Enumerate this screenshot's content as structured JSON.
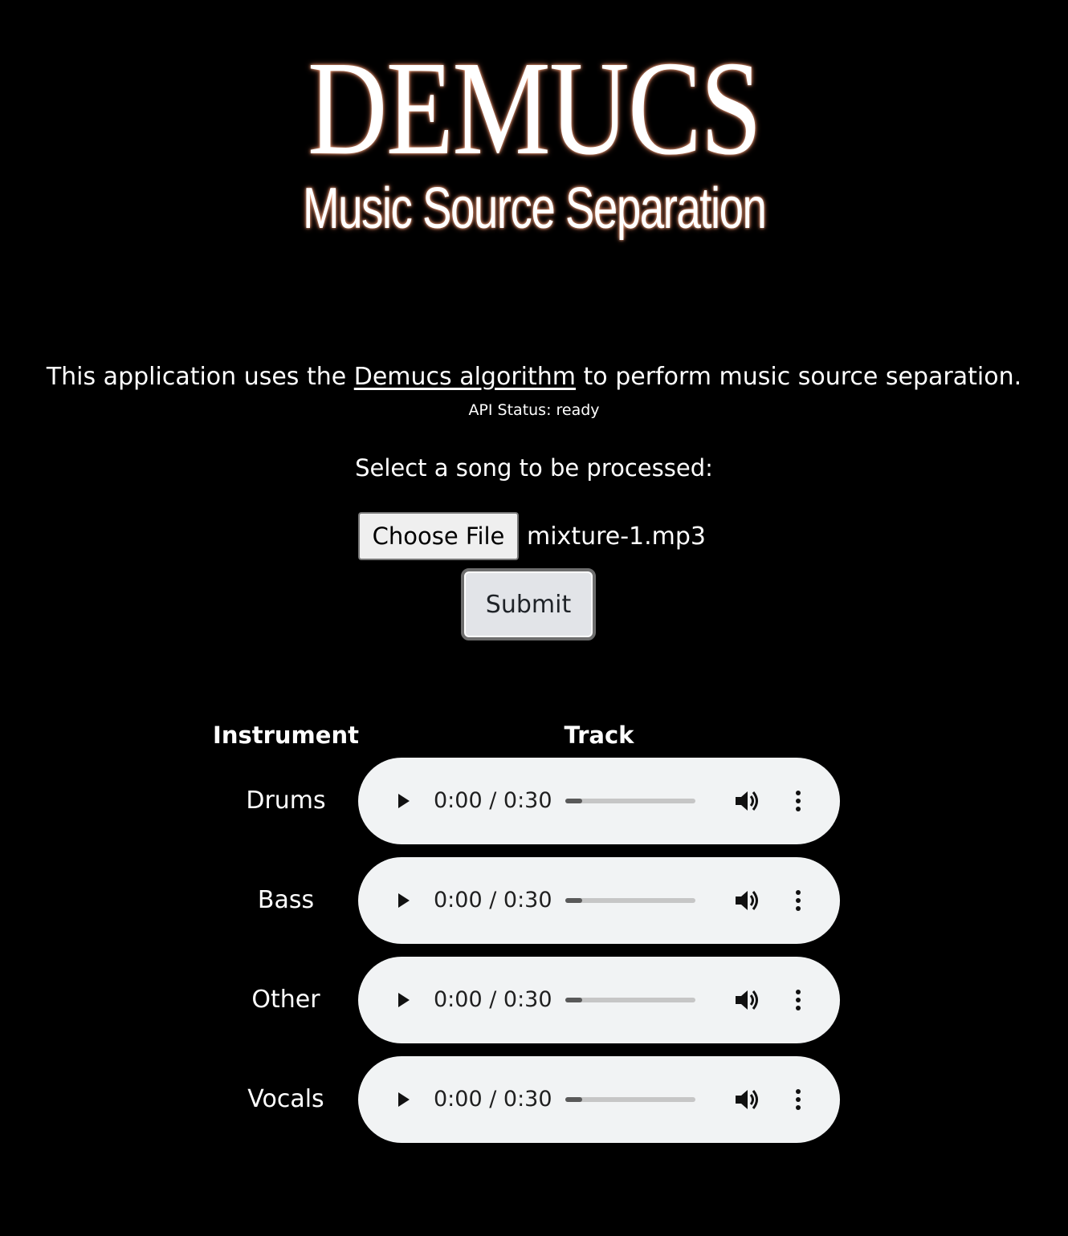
{
  "logo": {
    "title": "DEMUCS",
    "subtitle": "Music Source Separation"
  },
  "intro": {
    "prefix": "This application uses the ",
    "link_text": "Demucs algorithm",
    "suffix": " to perform music source separation."
  },
  "status": {
    "text": "API Status: ready"
  },
  "upload": {
    "label": "Select a song to be processed:",
    "choose_label": "Choose File",
    "file_name": "mixture-1.mp3",
    "submit_label": "Submit"
  },
  "table": {
    "headers": {
      "instrument": "Instrument",
      "track": "Track"
    },
    "rows": [
      {
        "instrument": "Drums",
        "time": "0:00 / 0:30",
        "progress": 0.13
      },
      {
        "instrument": "Bass",
        "time": "0:00 / 0:30",
        "progress": 0.13
      },
      {
        "instrument": "Other",
        "time": "0:00 / 0:30",
        "progress": 0.13
      },
      {
        "instrument": "Vocals",
        "time": "0:00 / 0:30",
        "progress": 0.13
      }
    ]
  },
  "icons": {
    "play": "play-icon",
    "volume": "volume-icon",
    "menu": "more-vertical-icon"
  },
  "colors": {
    "background": "#000000",
    "text": "#ffffff",
    "glow": "#ffb089",
    "player_bg": "#f1f3f4"
  }
}
